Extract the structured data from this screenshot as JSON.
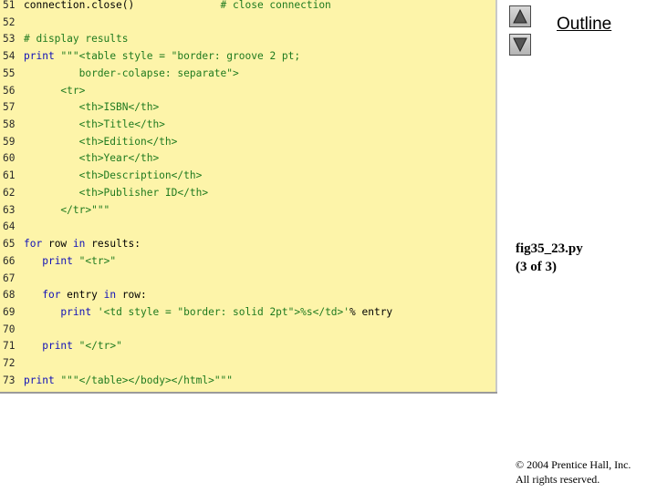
{
  "code_lines": [
    {
      "n": "51",
      "parts": [
        [
          "",
          "connection.close()              "
        ],
        [
          "cm",
          "# close connection"
        ]
      ]
    },
    {
      "n": "52",
      "parts": []
    },
    {
      "n": "53",
      "parts": [
        [
          "cm",
          "# display results"
        ]
      ]
    },
    {
      "n": "54",
      "parts": [
        [
          "kw",
          "print"
        ],
        [
          "",
          " "
        ],
        [
          "st",
          "\"\"\"<table style = \"border: groove 2 pt;"
        ]
      ]
    },
    {
      "n": "55",
      "parts": [
        [
          "st",
          "         border-colapse: separate\">"
        ]
      ]
    },
    {
      "n": "56",
      "parts": [
        [
          "st",
          "      <tr>"
        ]
      ]
    },
    {
      "n": "57",
      "parts": [
        [
          "st",
          "         <th>ISBN</th>"
        ]
      ]
    },
    {
      "n": "58",
      "parts": [
        [
          "st",
          "         <th>Title</th>"
        ]
      ]
    },
    {
      "n": "59",
      "parts": [
        [
          "st",
          "         <th>Edition</th>"
        ]
      ]
    },
    {
      "n": "60",
      "parts": [
        [
          "st",
          "         <th>Year</th>"
        ]
      ]
    },
    {
      "n": "61",
      "parts": [
        [
          "st",
          "         <th>Description</th>"
        ]
      ]
    },
    {
      "n": "62",
      "parts": [
        [
          "st",
          "         <th>Publisher ID</th>"
        ]
      ]
    },
    {
      "n": "63",
      "parts": [
        [
          "st",
          "      </tr>\"\"\""
        ]
      ]
    },
    {
      "n": "64",
      "parts": []
    },
    {
      "n": "65",
      "parts": [
        [
          "kw",
          "for"
        ],
        [
          "",
          " row "
        ],
        [
          "kw",
          "in"
        ],
        [
          "",
          " results:"
        ]
      ]
    },
    {
      "n": "66",
      "parts": [
        [
          "",
          "   "
        ],
        [
          "kw",
          "print"
        ],
        [
          "",
          " "
        ],
        [
          "st",
          "\"<tr>\""
        ]
      ]
    },
    {
      "n": "67",
      "parts": []
    },
    {
      "n": "68",
      "parts": [
        [
          "",
          "   "
        ],
        [
          "kw",
          "for"
        ],
        [
          "",
          " entry "
        ],
        [
          "kw",
          "in"
        ],
        [
          "",
          " row:"
        ]
      ]
    },
    {
      "n": "69",
      "parts": [
        [
          "",
          "      "
        ],
        [
          "kw",
          "print"
        ],
        [
          "",
          " "
        ],
        [
          "st",
          "'<td style = \"border: solid 2pt\">%s</td>'"
        ],
        [
          "",
          "% entry"
        ]
      ]
    },
    {
      "n": "70",
      "parts": []
    },
    {
      "n": "71",
      "parts": [
        [
          "",
          "   "
        ],
        [
          "kw",
          "print"
        ],
        [
          "",
          " "
        ],
        [
          "st",
          "\"</tr>\""
        ]
      ]
    },
    {
      "n": "72",
      "parts": []
    },
    {
      "n": "73",
      "parts": [
        [
          "kw",
          "print"
        ],
        [
          "",
          " "
        ],
        [
          "st",
          "\"\"\"</table></body></html>\"\"\""
        ]
      ]
    }
  ],
  "nav": {
    "title": "Outline",
    "up_icon": "triangle-up-icon",
    "down_icon": "triangle-down-icon"
  },
  "slide": {
    "filename": "fig35_23.py",
    "page": "(3 of 3)"
  },
  "footer": {
    "copyright": "© 2004 Prentice Hall, Inc.",
    "rights": "All rights reserved."
  },
  "colors": {
    "panel_bg": "#fdf4a9",
    "keyword": "#1010b8",
    "comment_string": "#1f7a1f"
  }
}
